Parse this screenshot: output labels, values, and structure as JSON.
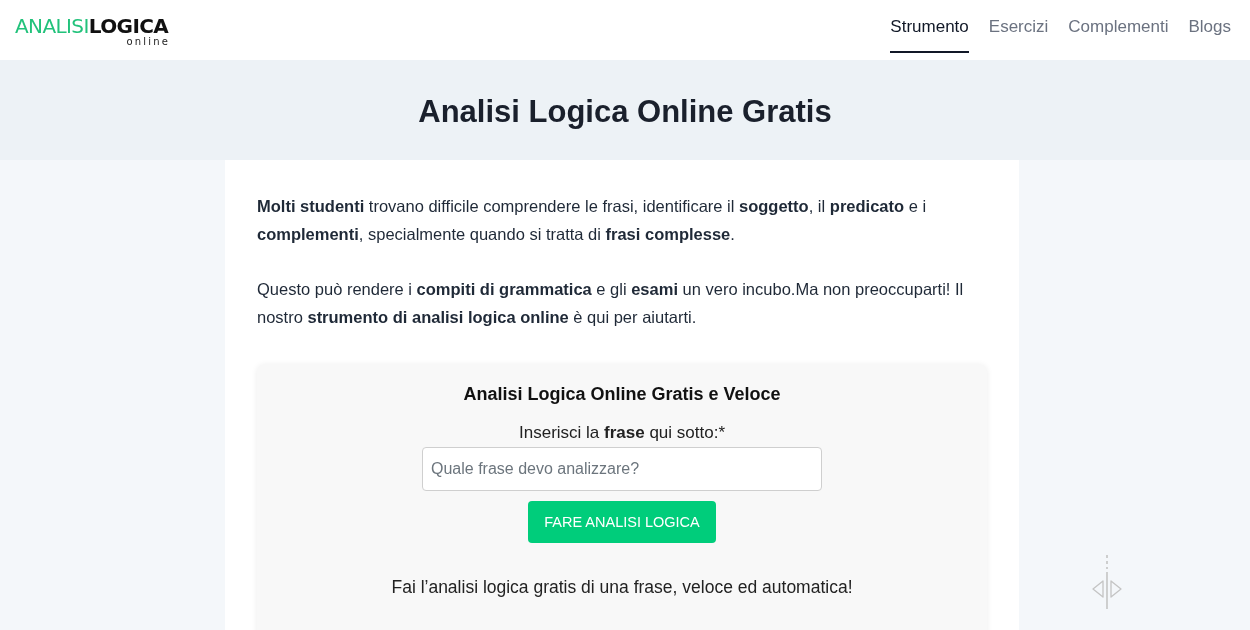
{
  "header": {
    "logo": {
      "part_1": "ANALISI",
      "part_2": "LOGICA",
      "tagline": "online"
    },
    "nav": [
      {
        "label": "Strumento",
        "selected": true
      },
      {
        "label": "Esercizi",
        "selected": false
      },
      {
        "label": "Complementi",
        "selected": false
      },
      {
        "label": "Blogs",
        "selected": false
      }
    ]
  },
  "hero": {
    "title": "Analisi Logica Online Gratis"
  },
  "intro": [
    "**Molti studenti** trovano difficile comprendere le frasi, identificare il **soggetto**, il **predicato** e i **complementi**, specialmente quando si tratta di **frasi complesse**.",
    "Questo può rendere i **compiti di grammatica** e gli **esami** un vero incubo.Ma non preoccuparti! Il nostro **strumento di analisi logica online** è qui per aiutarti."
  ],
  "tool_card": {
    "title": "Analisi Logica Online Gratis e Veloce",
    "label": "Inserisci la **frase** qui sotto:*",
    "input": {
      "placeholder": "Quale frase devo analizzare?"
    },
    "button": "FARE ANALISI LOGICA",
    "note": "Fai l’analisi logica gratis di una frase, veloce ed automatica!"
  }
}
